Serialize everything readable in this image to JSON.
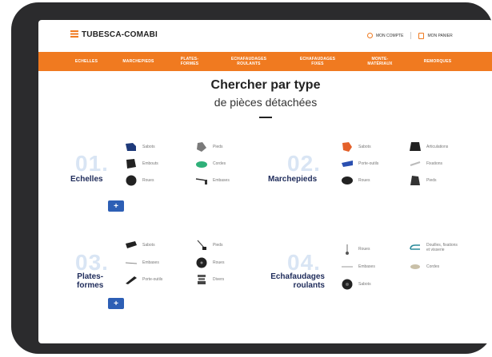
{
  "header": {
    "logo_text": "TUBESCA-COMABI",
    "account_label": "MON COMPTE",
    "cart_label": "MON PANIER"
  },
  "nav": [
    {
      "label": "ECHELLES"
    },
    {
      "label": "MARCHEPIEDS"
    },
    {
      "label": "PLATES-\nFORMES"
    },
    {
      "label": "ECHAFAUDAGES\nROULANTS"
    },
    {
      "label": "ECHAFAUDAGES\nFIXES"
    },
    {
      "label": "MONTE-\nMATÉRIAUX"
    },
    {
      "label": "REMORQUES"
    }
  ],
  "heading": {
    "line1": "Chercher par type",
    "line2": "de pièces détachées"
  },
  "categories": [
    {
      "number": "01.",
      "name": "Echelles",
      "plus": "+",
      "parts": [
        {
          "label": "Sabots",
          "icon": "shoe-icon"
        },
        {
          "label": "Pieds",
          "icon": "foot-icon"
        },
        {
          "label": "Embouts",
          "icon": "endcap-icon"
        },
        {
          "label": "Cordes",
          "icon": "rope-icon"
        },
        {
          "label": "Roues",
          "icon": "wheel-icon"
        },
        {
          "label": "Embases",
          "icon": "base-icon"
        }
      ]
    },
    {
      "number": "02.",
      "name": "Marchepieds",
      "parts": [
        {
          "label": "Sabots",
          "icon": "shoe-icon"
        },
        {
          "label": "Articulations",
          "icon": "hinge-icon"
        },
        {
          "label": "Porte-outils",
          "icon": "tool-holder-icon"
        },
        {
          "label": "Fixations",
          "icon": "fixing-icon"
        },
        {
          "label": "Roues",
          "icon": "wheel-icon"
        },
        {
          "label": "Pieds",
          "icon": "foot-icon"
        }
      ]
    },
    {
      "number": "03.",
      "name": "Plates-\nformes",
      "plus": "+",
      "parts": [
        {
          "label": "Sabots",
          "icon": "shoe-icon"
        },
        {
          "label": "Pieds",
          "icon": "foot-icon"
        },
        {
          "label": "Embases",
          "icon": "base-icon"
        },
        {
          "label": "Roues",
          "icon": "wheel-icon"
        },
        {
          "label": "Porte-outils",
          "icon": "tool-holder-icon"
        },
        {
          "label": "Divers",
          "icon": "misc-icon"
        }
      ]
    },
    {
      "number": "04.",
      "name": "Echafaudages\nroulants",
      "parts": [
        {
          "label": "Roues",
          "icon": "wheel-icon"
        },
        {
          "label": "Douilles, fixations\net visserie",
          "icon": "sleeve-icon"
        },
        {
          "label": "Embases",
          "icon": "base-icon"
        },
        {
          "label": "Cordes",
          "icon": "rope-icon"
        },
        {
          "label": "Sabots",
          "icon": "shoe-icon"
        }
      ]
    }
  ],
  "colors": {
    "accent": "#f07a20",
    "navy": "#1e2b5a",
    "button": "#2d5fb5",
    "number": "#d9e5f4"
  }
}
